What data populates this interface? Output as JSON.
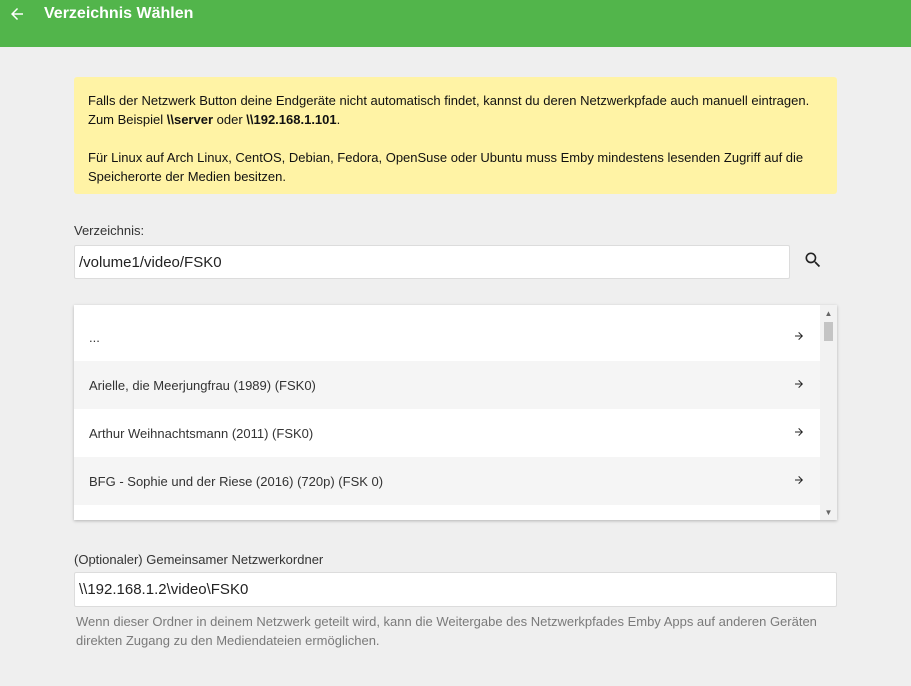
{
  "header": {
    "title": "Verzeichnis Wählen",
    "back_icon": "arrow-left-icon",
    "color": "#52b54b"
  },
  "info": {
    "line1_before": "Falls der Netzwerk Button deine Endgeräte nicht automatisch findet, kannst du deren Netzwerkpfade auch manuell eintragen. Zum Beispiel ",
    "example1": "\\\\server",
    "middle": " oder ",
    "example2": "\\\\192.168.1.101",
    "line1_after": ".",
    "paragraph2": "Für Linux auf Arch Linux, CentOS, Debian, Fedora, OpenSuse oder Ubuntu muss Emby mindestens lesenden Zugriff auf die Speicherorte der Medien besitzen.",
    "background": "#fff3a5"
  },
  "directory": {
    "label": "Verzeichnis:",
    "value": "/volume1/video/FSK0",
    "search_icon": "search-icon"
  },
  "list": {
    "items": [
      {
        "label": "..."
      },
      {
        "label": "Arielle, die Meerjungfrau (1989) (FSK0)"
      },
      {
        "label": "Arthur Weihnachtsmann (2011) (FSK0)"
      },
      {
        "label": "BFG - Sophie und der Riese (2016) (720p) (FSK 0)"
      }
    ],
    "arrow_icon": "arrow-right-icon"
  },
  "network": {
    "label": "(Optionaler) Gemeinsamer Netzwerkordner",
    "value": "\\\\192.168.1.2\\video\\FSK0",
    "help": "Wenn dieser Ordner in deinem Netzwerk geteilt wird, kann die Weitergabe des Netzwerkpfades Emby Apps auf anderen Geräten direkten Zugang zu den Mediendateien ermöglichen."
  }
}
